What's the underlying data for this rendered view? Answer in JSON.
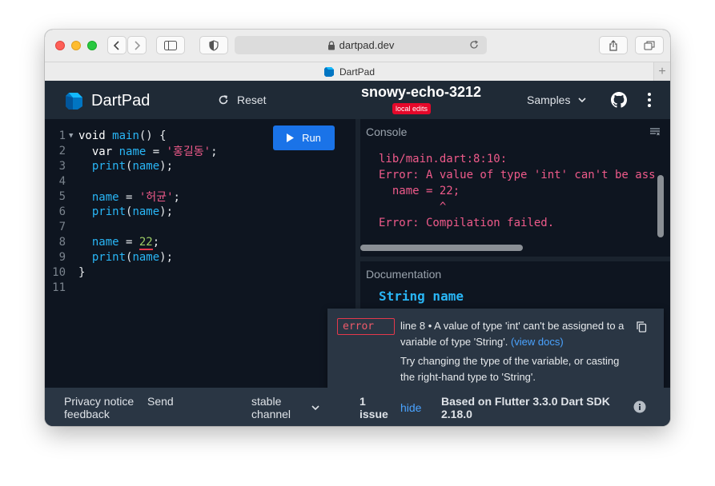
{
  "browser": {
    "url": "dartpad.dev",
    "tab_title": "DartPad"
  },
  "header": {
    "app_name": "DartPad",
    "reset_label": "Reset",
    "pad_title": "snowy-echo-3212",
    "badge": "local edits",
    "samples_label": "Samples"
  },
  "editor": {
    "run_label": "Run",
    "lines": [
      {
        "n": "1",
        "text": "void main() {"
      },
      {
        "n": "2",
        "text": "  var name = '홍길동';"
      },
      {
        "n": "3",
        "text": "  print(name);"
      },
      {
        "n": "4",
        "text": ""
      },
      {
        "n": "5",
        "text": "  name = '허균';"
      },
      {
        "n": "6",
        "text": "  print(name);"
      },
      {
        "n": "7",
        "text": ""
      },
      {
        "n": "8",
        "text": "  name = 22;"
      },
      {
        "n": "9",
        "text": "  print(name);"
      },
      {
        "n": "10",
        "text": "}"
      },
      {
        "n": "11",
        "text": ""
      }
    ]
  },
  "console": {
    "title": "Console",
    "output": [
      "lib/main.dart:8:10:",
      "Error: A value of type 'int' can't be ass",
      "  name = 22;",
      "         ^",
      "Error: Compilation failed."
    ]
  },
  "documentation": {
    "title": "Documentation",
    "symbol": "String name"
  },
  "issue_popup": {
    "tag": "error",
    "message": "line 8 • A value of type 'int' can't be assigned to a variable of type 'String'.",
    "link": "(view docs)",
    "hint": "Try changing the type of the variable, or casting the right-hand type to 'String'."
  },
  "footer": {
    "privacy": "Privacy notice",
    "send": "Send",
    "feedback": "feedback",
    "channel_1": "stable",
    "channel_2": "channel",
    "issues_count": "1",
    "issues_word": "issue",
    "hide": "hide",
    "sdk_1": "Based on Flutter 3.3.0 Dart SDK",
    "sdk_2": "2.18.0"
  },
  "colors": {
    "accent": "#1a73e8",
    "error": "#e5082a",
    "string": "#ef5a8a",
    "identifier": "#29b6f6"
  }
}
